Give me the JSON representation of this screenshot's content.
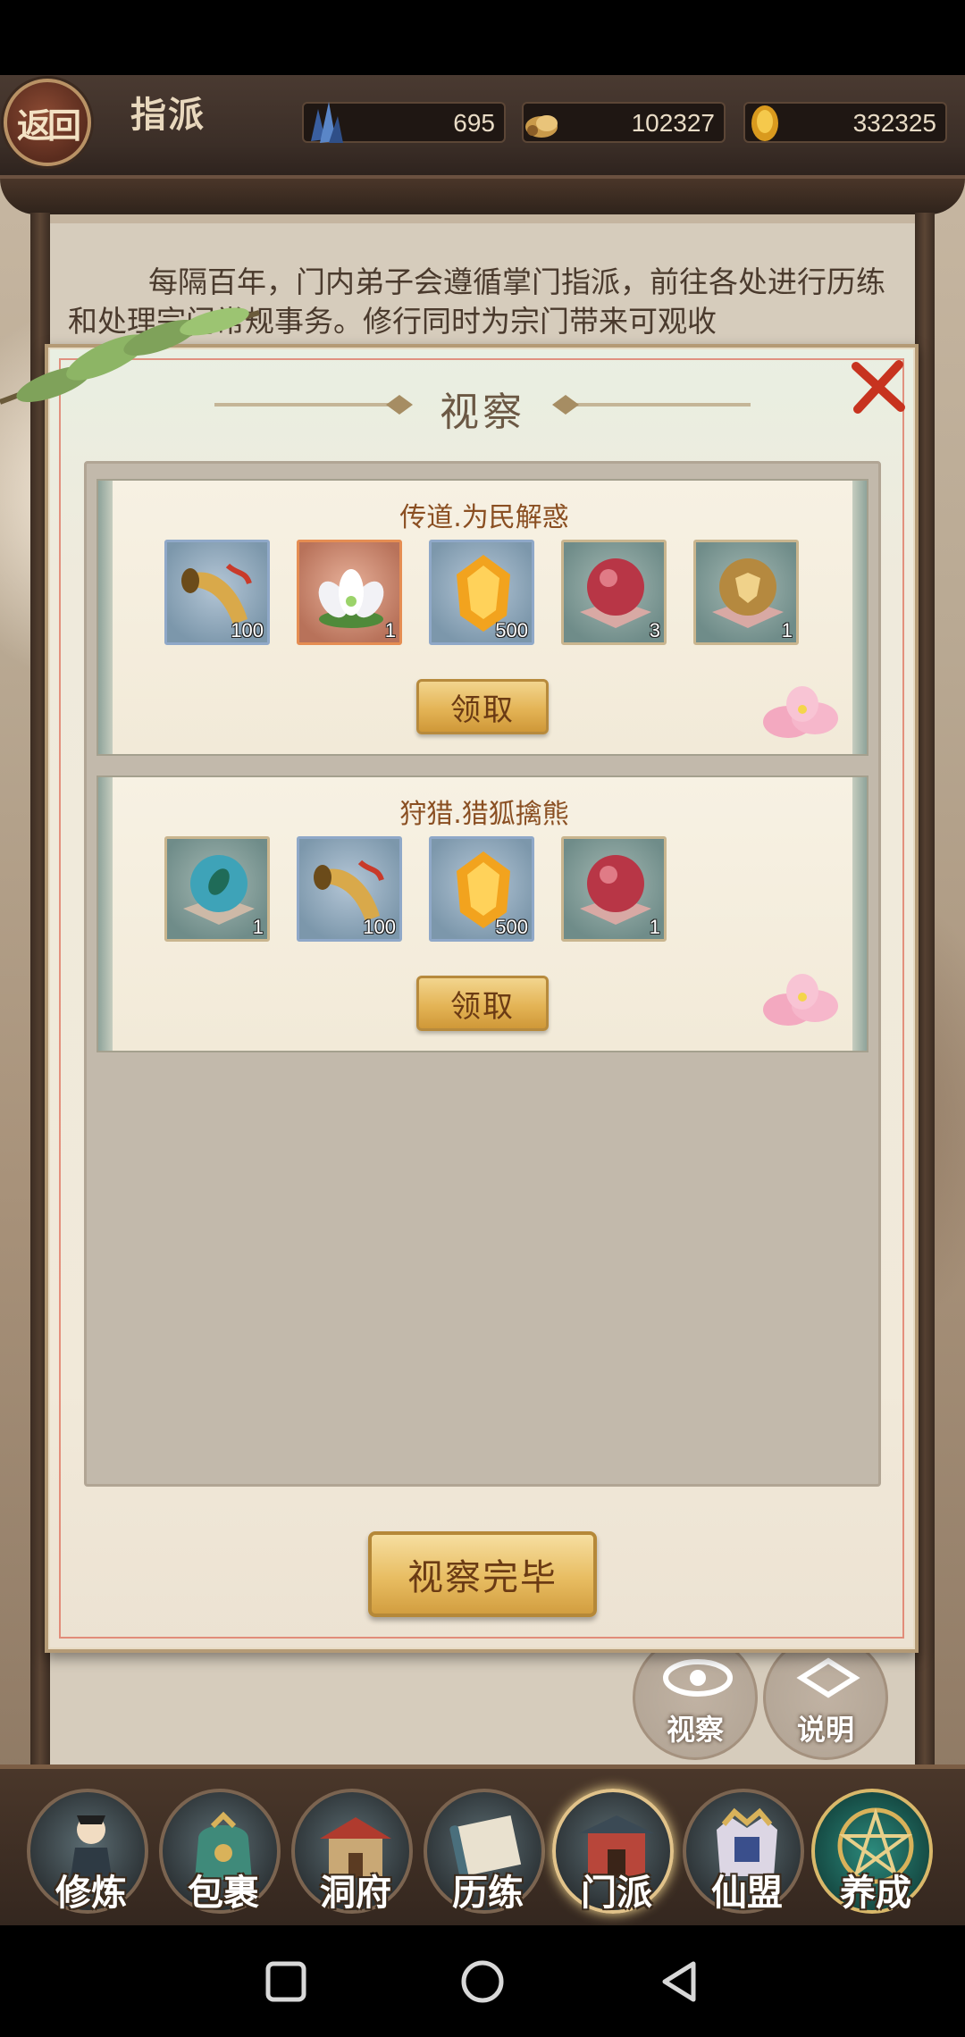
{
  "header": {
    "back_label": "返回",
    "title": "指派",
    "resources": [
      {
        "icon": "crystal-icon",
        "value": "695"
      },
      {
        "icon": "scroll-icon",
        "value": "102327"
      },
      {
        "icon": "gold-ingot-icon",
        "value": "332325"
      }
    ]
  },
  "intro_text": "每隔百年，门内弟子会遵循掌门指派，前往各处进行历练和处理宗门常规事务。修行同时为宗门带来可观收",
  "background_buttons": {
    "inspect_label": "视察",
    "explain_label": "说明"
  },
  "modal": {
    "title": "视察",
    "close_icon": "close-icon",
    "cards": [
      {
        "title": "传道.为民解惑",
        "claim_label": "领取",
        "items": [
          {
            "icon": "horn-icon",
            "qty": "100",
            "frame": "blue"
          },
          {
            "icon": "lotus-icon",
            "qty": "1",
            "frame": "orange"
          },
          {
            "icon": "amber-crystal-icon",
            "qty": "500",
            "frame": "blue"
          },
          {
            "icon": "red-orb-icon",
            "qty": "3",
            "frame": "green"
          },
          {
            "icon": "shield-orb-icon",
            "qty": "1",
            "frame": "green"
          }
        ]
      },
      {
        "title": "狩猎.猎狐擒熊",
        "claim_label": "领取",
        "items": [
          {
            "icon": "teal-orb-icon",
            "qty": "1",
            "frame": "green"
          },
          {
            "icon": "horn-icon",
            "qty": "100",
            "frame": "blue"
          },
          {
            "icon": "amber-crystal-icon",
            "qty": "500",
            "frame": "blue"
          },
          {
            "icon": "red-orb-icon",
            "qty": "1",
            "frame": "green"
          }
        ]
      }
    ],
    "done_label": "视察完毕"
  },
  "bottom_nav": [
    {
      "label": "修炼",
      "icon": "cultivator-icon"
    },
    {
      "label": "包裹",
      "icon": "bag-icon"
    },
    {
      "label": "洞府",
      "icon": "cave-house-icon"
    },
    {
      "label": "历练",
      "icon": "scroll-map-icon"
    },
    {
      "label": "门派",
      "icon": "sect-gate-icon",
      "active": true
    },
    {
      "label": "仙盟",
      "icon": "alliance-icon"
    },
    {
      "label": "养成",
      "icon": "pentagram-icon"
    }
  ],
  "system_nav": {
    "recent_icon": "square-icon",
    "home_icon": "circle-icon",
    "back_icon": "triangle-back-icon"
  }
}
